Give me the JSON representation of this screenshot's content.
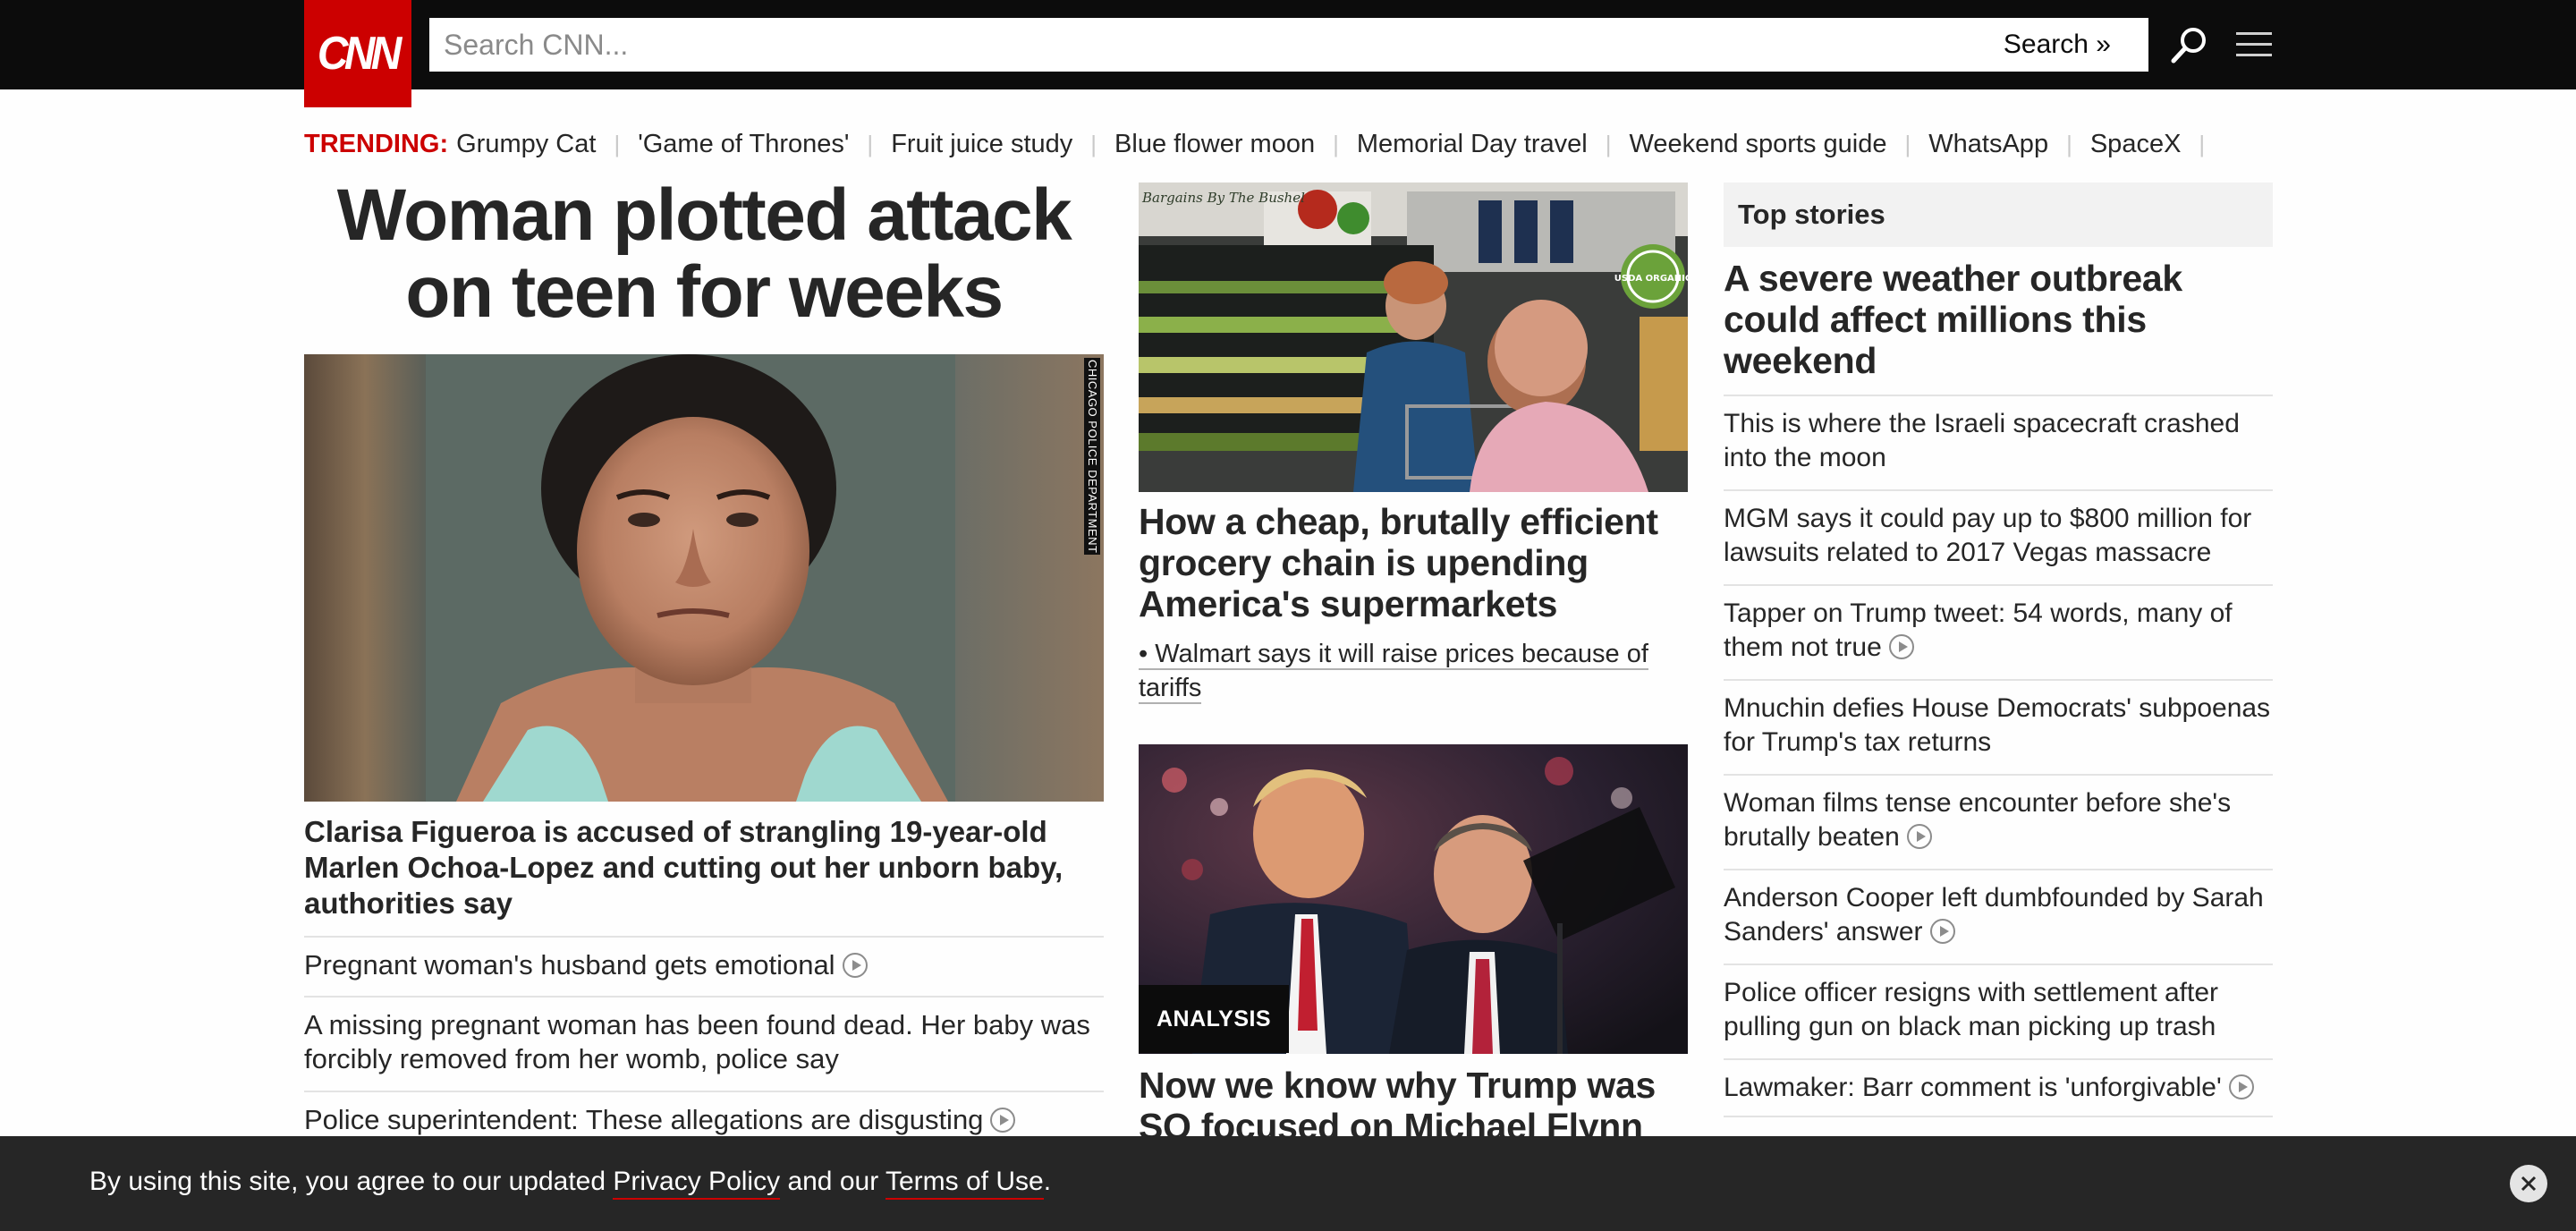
{
  "header": {
    "logo_text": "CNN",
    "search_placeholder": "Search CNN...",
    "search_button": "Search »",
    "icons": [
      "search-icon",
      "menu-icon"
    ],
    "accent_color": "#cc0000"
  },
  "trending": {
    "label": "TRENDING:",
    "items": [
      "Grumpy Cat",
      "'Game of Thrones'",
      "Fruit juice study",
      "Blue flower moon",
      "Memorial Day travel",
      "Weekend sports guide",
      "WhatsApp",
      "SpaceX"
    ],
    "separator": "|"
  },
  "main": {
    "headline": "Woman plotted attack on teen for weeks",
    "photo_credit": "CHICAGO POLICE DEPARTMENT",
    "caption": "Clarisa Figueroa is accused of strangling 19-year-old Marlen Ochoa-Lopez and cutting out her unborn baby, authorities say",
    "related": [
      {
        "text": "Pregnant woman's husband gets emotional",
        "video": true
      },
      {
        "text": "A missing pregnant woman has been found dead. Her baby was forcibly removed from her womb, police say",
        "video": false
      },
      {
        "text": "Police superintendent: These allegations are disgusting",
        "video": true
      }
    ]
  },
  "middle": {
    "story1": {
      "headline": "How a cheap, brutally efficient grocery chain is upending America's supermarkets",
      "sub": "• Walmart says it will raise prices because of tariffs",
      "photo_sign": "Bargains By The Bushel",
      "badge_text": "USDA ORGANIC"
    },
    "story2": {
      "badge": "ANALYSIS",
      "headline": "Now we know why Trump was SO focused on Michael Flynn"
    }
  },
  "top_stories": {
    "title": "Top stories",
    "lead": "A severe weather outbreak could affect millions this weekend",
    "items": [
      {
        "text": "This is where the Israeli spacecraft crashed into the moon",
        "video": false
      },
      {
        "text": "MGM says it could pay up to $800 million for lawsuits related to 2017 Vegas massacre",
        "video": false
      },
      {
        "text": "Tapper on Trump tweet: 54 words, many of them not true",
        "video": true
      },
      {
        "text": "Mnuchin defies House Democrats' subpoenas for Trump's tax returns",
        "video": false
      },
      {
        "text": "Woman films tense encounter before she's brutally beaten",
        "video": true
      },
      {
        "text": "Anderson Cooper left dumbfounded by Sarah Sanders' answer",
        "video": true
      },
      {
        "text": "Police officer resigns with settlement after pulling gun on black man picking up trash",
        "video": false
      },
      {
        "text": "Lawmaker: Barr comment is 'unforgivable'",
        "video": true
      }
    ]
  },
  "cookie_bar": {
    "prefix": "By using this site, you agree to our updated",
    "privacy": "Privacy Policy",
    "middle": "and our",
    "terms": "Terms of Use",
    "suffix": "."
  }
}
